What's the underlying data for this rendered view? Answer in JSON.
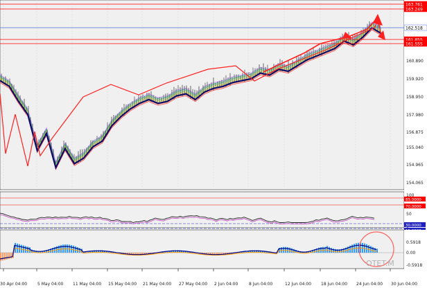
{
  "colors": {
    "background": "#ffffff",
    "plot_bg": "#f0f0f0",
    "grid": "#c8c8c8",
    "price_line": "#ff0000",
    "current_price_line": "#4a6fd8",
    "current_price_tag": "#4a6fd8",
    "ma_main": "#0d0d6b",
    "rsi_line": "#222222",
    "rsi_level_upper": "#ff0000",
    "rsi_level_lower": "#2020c0",
    "macd_pos": "#3399ff",
    "macd_neg": "#ff9966",
    "macd_signal": "#ff9900",
    "macd_main": "#000080",
    "annotation": "#ff2020"
  },
  "price_axis": {
    "ticks": [
      "160.890",
      "159.920",
      "158.950",
      "157.980",
      "156.875",
      "155.040",
      "154.965",
      "154.065"
    ],
    "levels": [
      {
        "text": "163.761",
        "kind": "red"
      },
      {
        "text": "163.249",
        "kind": "red"
      },
      {
        "text": "162.518",
        "kind": "current"
      },
      {
        "text": "161.855",
        "kind": "red"
      },
      {
        "text": "161.555",
        "kind": "red"
      }
    ]
  },
  "rsi_axis": {
    "ticks": [
      "100",
      "50",
      "0"
    ],
    "tags": [
      {
        "text": "85.0000",
        "kind": "red"
      },
      {
        "text": "70.0000",
        "kind": "red"
      },
      {
        "text": "30.0000",
        "kind": "blue"
      },
      {
        "text": "15.0000",
        "kind": "blue"
      }
    ]
  },
  "macd_axis": {
    "ticks": [
      "0.5918",
      "0.00",
      "-0.5918"
    ]
  },
  "time_axis": {
    "labels": [
      "30 Apr 04:00",
      "5 May 04:00",
      "11 May 04:00",
      "15 May 04:00",
      "21 May 04:00",
      "27 May 04:00",
      "2 Jun 04:00",
      "8 Jun 04:00",
      "12 Jun 04:00",
      "18 Jun 04:00",
      "24 Jun 04:00",
      "30 Jun 04:00"
    ]
  },
  "watermark": "OTET.M",
  "chart_data": {
    "type": "line",
    "series": [
      {
        "values": [
          159.7,
          159.4,
          158.6,
          157.9,
          156.0,
          156.9,
          155.1,
          156.1,
          155.3,
          155.6,
          156.2,
          156.5,
          157.3,
          157.8,
          158.2,
          158.5,
          158.7,
          158.5,
          158.6,
          158.9,
          159.0,
          158.7,
          159.1,
          159.3,
          159.4,
          159.6,
          159.7,
          159.8,
          160.1,
          160.0,
          160.3,
          160.2,
          160.5,
          160.8,
          161.0,
          161.2,
          161.4,
          161.8,
          161.6,
          162.0,
          162.5,
          162.2
        ]
      }
    ],
    "ylim": [
      154.0,
      163.9
    ]
  }
}
